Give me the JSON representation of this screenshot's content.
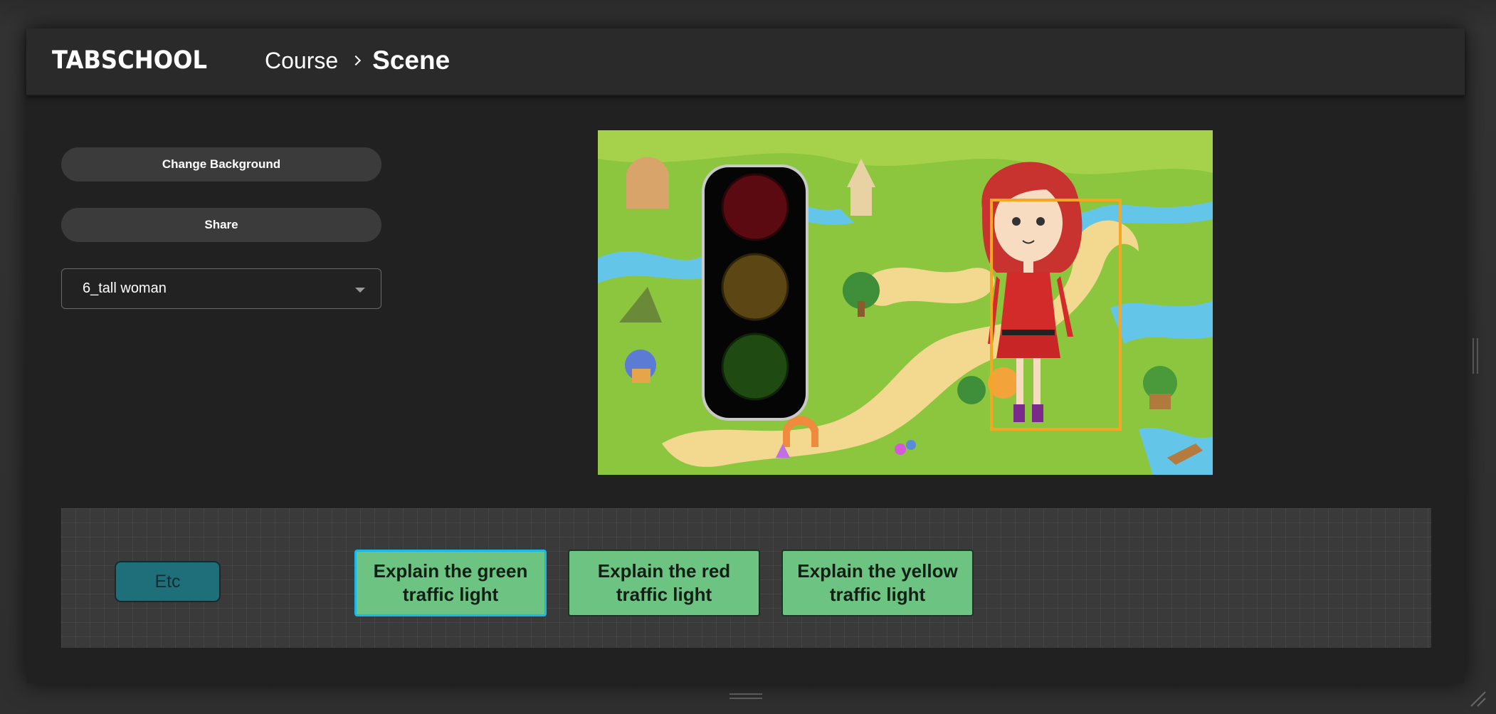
{
  "app": {
    "logo": "TABSCHOOL"
  },
  "breadcrumb": {
    "course": "Course",
    "scene": "Scene"
  },
  "sidebar": {
    "change_background_label": "Change Background",
    "share_label": "Share",
    "character_select": {
      "selected": "6_tall woman"
    }
  },
  "canvas": {
    "background": "fantasy-island-map",
    "objects": [
      "traffic-light",
      "tall-woman-character"
    ],
    "selected_object": "tall-woman-character",
    "selection_color": "#f5a623"
  },
  "actions": {
    "etc_label": "Etc",
    "cards": [
      {
        "label": "Explain the green traffic light",
        "selected": true
      },
      {
        "label": "Explain the red traffic light",
        "selected": false
      },
      {
        "label": "Explain the yellow traffic light",
        "selected": false
      }
    ]
  },
  "colors": {
    "card_fill": "#6dc482",
    "card_selected_border": "#1ab8e8",
    "etc_fill": "#1f6f7b"
  }
}
